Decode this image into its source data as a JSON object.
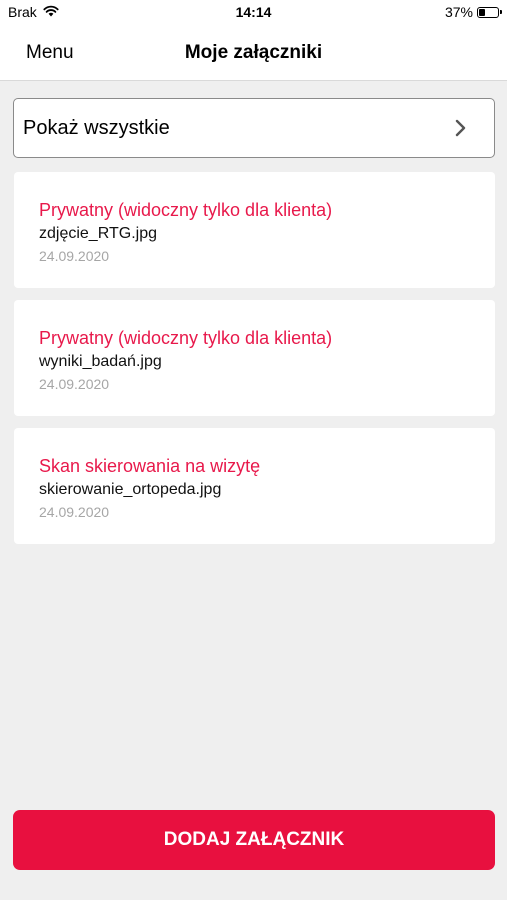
{
  "status_bar": {
    "carrier": "Brak",
    "time": "14:14",
    "battery": "37%",
    "wifi_icon": "wifi-icon",
    "battery_level": 0.37
  },
  "nav": {
    "menu_label": "Menu",
    "title": "Moje załączniki"
  },
  "filter": {
    "label": "Pokaż wszystkie",
    "icon": "chevron-right-icon"
  },
  "attachments": [
    {
      "title": "Prywatny (widoczny tylko dla klienta)",
      "filename": "zdjęcie_RTG.jpg",
      "date": "24.09.2020"
    },
    {
      "title": "Prywatny (widoczny tylko dla klienta)",
      "filename": "wyniki_badań.jpg",
      "date": "24.09.2020"
    },
    {
      "title": "Skan skierowania na wizytę",
      "filename": "skierowanie_ortopeda.jpg",
      "date": "24.09.2020"
    }
  ],
  "actions": {
    "add_label": "DODAJ ZAŁĄCZNIK"
  },
  "colors": {
    "accent": "#e8103f",
    "title_red": "#e8194b",
    "background": "#efefef",
    "date_gray": "#a6a6a6"
  }
}
